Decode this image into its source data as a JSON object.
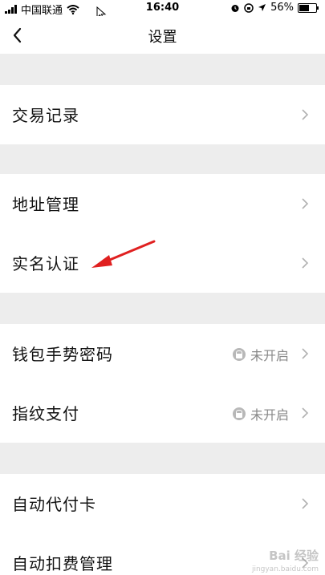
{
  "status_bar": {
    "carrier": "中国联通",
    "time": "16:40",
    "battery": "56%"
  },
  "nav": {
    "title": "设置"
  },
  "groups": [
    {
      "items": [
        {
          "label": "交易记录"
        }
      ]
    },
    {
      "items": [
        {
          "label": "地址管理"
        },
        {
          "label": "实名认证"
        }
      ]
    },
    {
      "items": [
        {
          "label": "钱包手势密码",
          "status": "未开启"
        },
        {
          "label": "指纹支付",
          "status": "未开启"
        }
      ]
    },
    {
      "items": [
        {
          "label": "自动代付卡"
        },
        {
          "label": "自动扣费管理"
        }
      ]
    }
  ],
  "watermark": {
    "brand": "Bai 经验",
    "url": "jingyan.baidu.com"
  },
  "colors": {
    "background": "#ededed",
    "surface": "#ffffff",
    "annotation_arrow": "#e02020"
  }
}
